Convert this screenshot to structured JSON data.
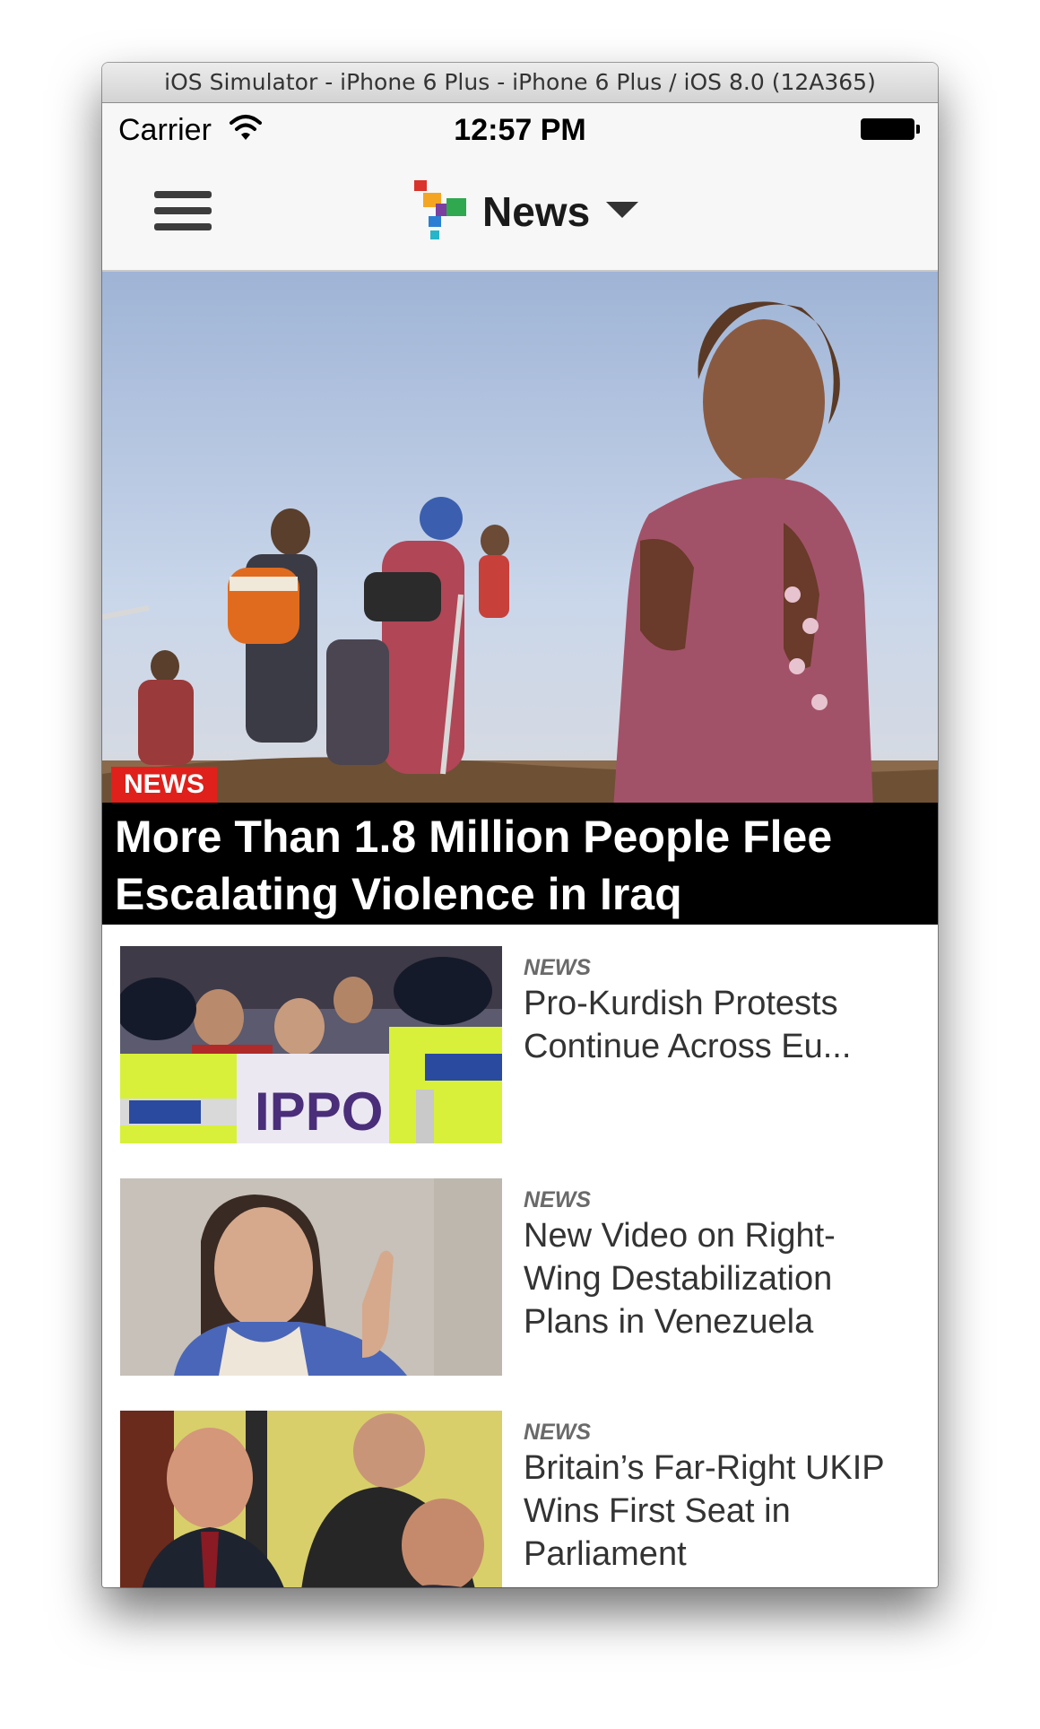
{
  "window": {
    "title": "iOS Simulator - iPhone 6 Plus - iPhone 6 Plus / iOS 8.0 (12A365)"
  },
  "status_bar": {
    "carrier": "Carrier",
    "time": "12:57 PM",
    "wifi_icon": "wifi-icon",
    "battery_icon": "battery-icon"
  },
  "nav": {
    "menu_icon": "hamburger-icon",
    "section_title": "News",
    "dropdown_icon": "chevron-down-icon"
  },
  "hero": {
    "category": "NEWS",
    "title": "More Than 1.8 Million People Flee Escalating Violence in Iraq"
  },
  "articles": [
    {
      "category": "NEWS",
      "title": "Pro-Kurdish Protests Continue Across Eu..."
    },
    {
      "category": "NEWS",
      "title": "New Video on Right-Wing Destabilization Plans in Venezuela"
    },
    {
      "category": "NEWS",
      "title": "Britain’s Far-Right UKIP Wins First Seat in Parliament"
    }
  ],
  "colors": {
    "badge_red": "#e0201b",
    "caption_black": "#000000",
    "bar_gray": "#f7f7f7"
  }
}
